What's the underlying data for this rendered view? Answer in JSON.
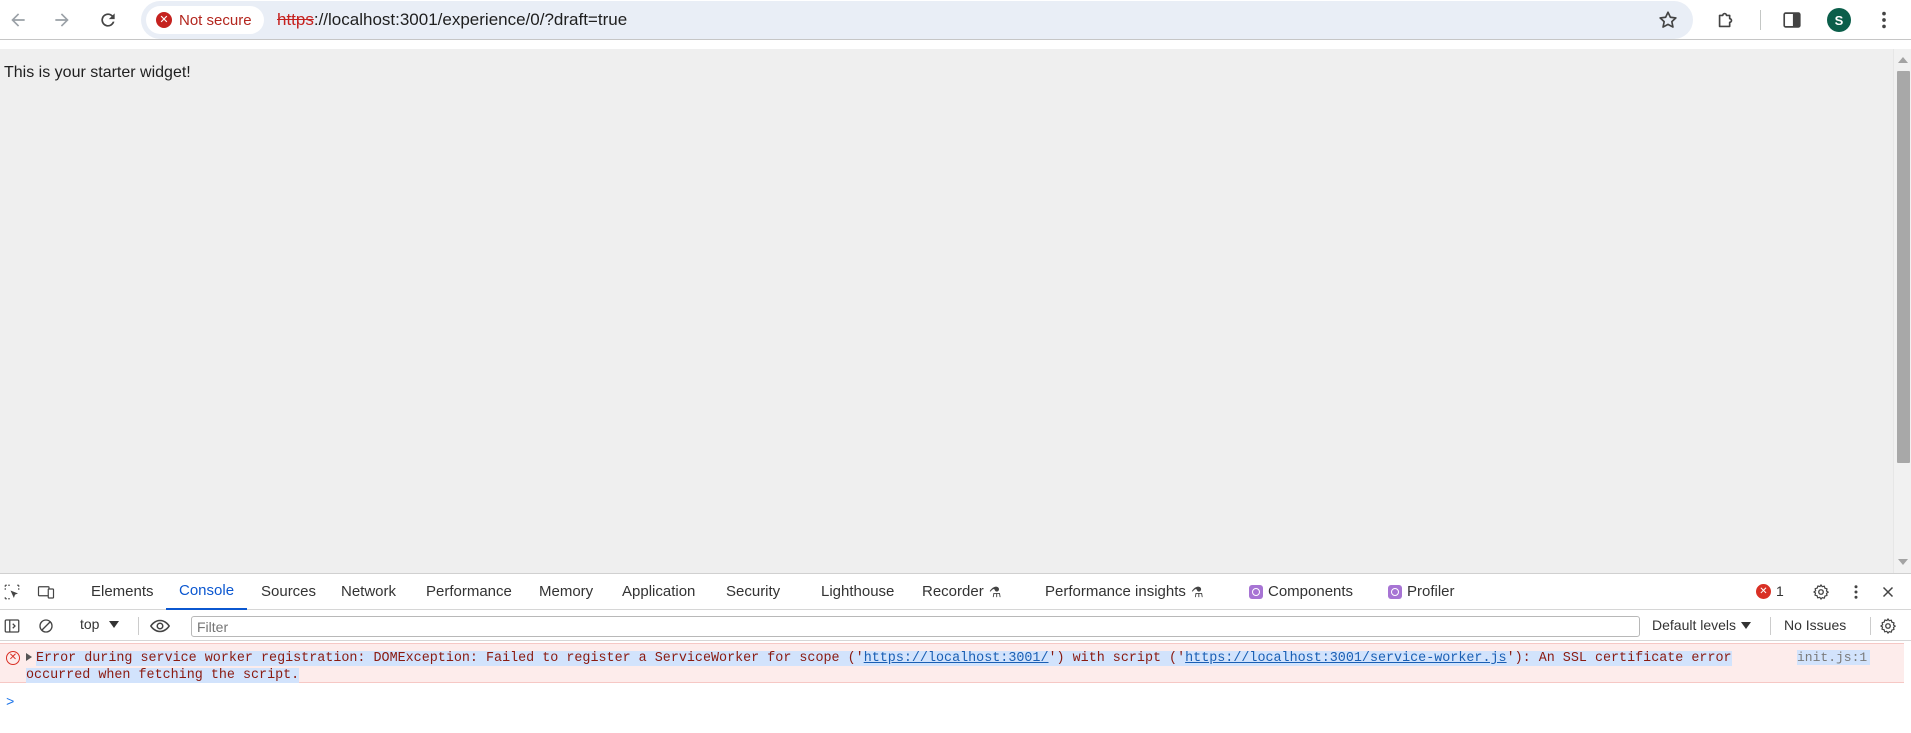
{
  "browser": {
    "security_chip": "Not secure",
    "url_scheme": "https",
    "url_rest": "://localhost:3001/experience/0/?draft=true",
    "profile_initial": "S"
  },
  "page": {
    "starter_text": "This is your starter widget!"
  },
  "devtools": {
    "tabs": [
      {
        "label": "Elements"
      },
      {
        "label": "Console"
      },
      {
        "label": "Sources"
      },
      {
        "label": "Network"
      },
      {
        "label": "Performance"
      },
      {
        "label": "Memory"
      },
      {
        "label": "Application"
      },
      {
        "label": "Security"
      },
      {
        "label": "Lighthouse"
      },
      {
        "label": "Recorder"
      },
      {
        "label": "Performance insights"
      },
      {
        "label": "Components"
      },
      {
        "label": "Profiler"
      }
    ],
    "active_tab": "Console",
    "error_count": "1",
    "context": "top",
    "filter_placeholder": "Filter",
    "levels_label": "Default levels",
    "issues_label": "No Issues",
    "message": {
      "prefix": "Error during service worker registration: DOMException: Failed to register a ServiceWorker for scope ('",
      "link1": "https://localhost:3001/",
      "middle": "') with script ('",
      "link2": "https://localhost:3001/service-worker.js",
      "suffix": "'): An SSL certificate error",
      "line2": "occurred when fetching the script.",
      "source": "init.js:1"
    },
    "prompt": ">"
  }
}
